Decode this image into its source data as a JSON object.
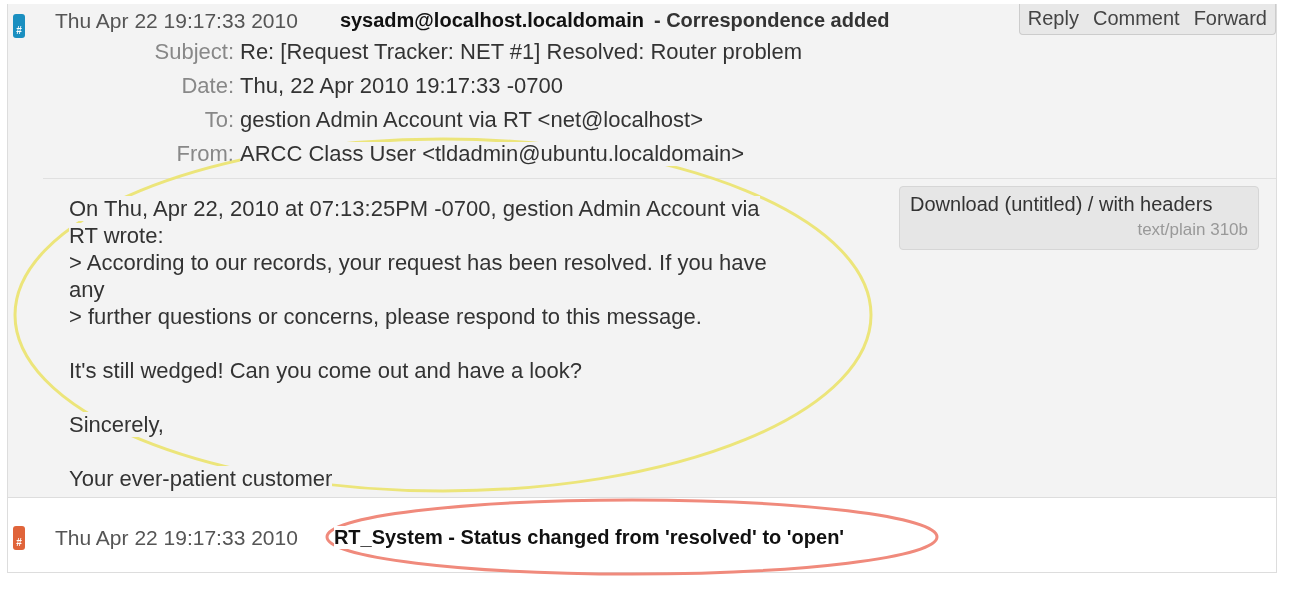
{
  "transactions": [
    {
      "kind": "correspondence",
      "color": "#1a8fc0",
      "icon": "#",
      "time": "Thu Apr 22 19:17:33 2010",
      "author": "sysadm@localhost.localdomain",
      "description": "- Correspondence added",
      "actions": [
        "Reply",
        "Comment",
        "Forward"
      ],
      "headers": [
        {
          "label": "Subject:",
          "value": "Re: [Request Tracker: NET #1] Resolved: Router problem"
        },
        {
          "label": "Date:",
          "value": "Thu, 22 Apr 2010 19:17:33 -0700"
        },
        {
          "label": "To:",
          "value": "gestion Admin Account via RT <net@localhost>"
        },
        {
          "label": "From:",
          "value": "ARCC Class User <tldadmin@ubuntu.localdomain>"
        }
      ],
      "body": [
        [
          "On Thu, Apr 22, 2010 at 07:13:25PM -0700, gestion Admin Account via",
          "RT wrote:",
          "> According to our records, your request has been resolved. If you have",
          "any",
          "> further questions or concerns, please respond to this message."
        ],
        [
          "It's still wedged! Can you come out and have a look?"
        ],
        [
          "Sincerely,"
        ],
        [
          "Your ever-patient customer"
        ]
      ],
      "attachment": {
        "link": "Download (untitled) / with headers",
        "meta": "text/plain 310b"
      }
    },
    {
      "kind": "status",
      "color": "#e0643a",
      "icon": "#",
      "time": "Thu Apr 22 19:17:33 2010",
      "description": "RT_System - Status changed from 'resolved' to 'open'"
    }
  ],
  "annotations": [
    {
      "color": "#ece57a"
    },
    {
      "color": "#f08a7c"
    }
  ]
}
